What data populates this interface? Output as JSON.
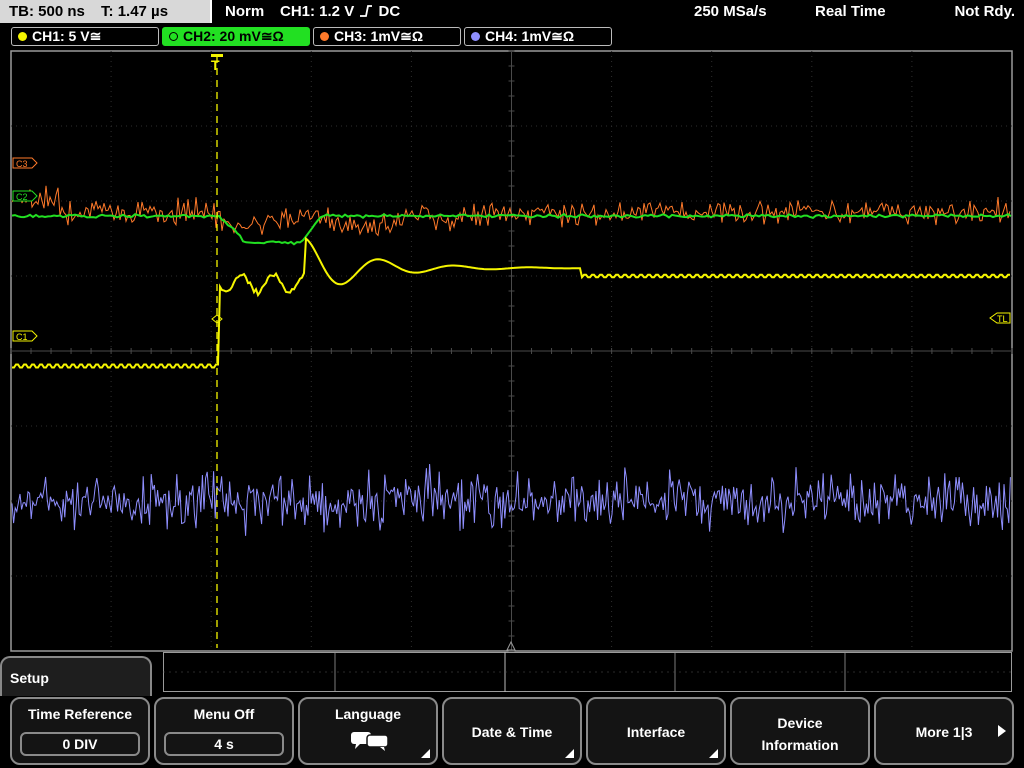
{
  "status": {
    "timebase": "TB: 500 ns",
    "trigger_time": "T: 1.47 µs",
    "mode": "Norm",
    "trigger_source": "CH1: 1.2 V",
    "trigger_coupling": "DC",
    "sample_rate": "250 MSa/s",
    "acquisition": "Real Time",
    "state": "Not Rdy."
  },
  "channels": [
    {
      "label": "CH1: 5 V",
      "suffix": "≅",
      "color": "#f5f500"
    },
    {
      "label": "CH2: 20 mV",
      "suffix": "≅Ω",
      "color": "#22e022"
    },
    {
      "label": "CH3: 1mV",
      "suffix": "≅Ω",
      "color": "#ff7a2a"
    },
    {
      "label": "CH4: 1mV",
      "suffix": "≅Ω",
      "color": "#8f8fff"
    }
  ],
  "markers": {
    "ch1": "C1",
    "ch2": "C2",
    "ch3": "C3",
    "trigger_level": "TL"
  },
  "waveform_data": {
    "grid_divisions": {
      "x": 10,
      "y": 8
    },
    "trigger_position_div": 2.07,
    "CH1": {
      "pre_trigger_div": -0.2,
      "post_trigger_steady_div": 1.0,
      "steady_from_div": 5.7
    },
    "CH2": {
      "baseline_div": 1.8,
      "dip_div": 1.45,
      "dip_start_div": 2.3,
      "dip_end_div": 2.9
    },
    "CH3": {
      "noise_center_div": 1.85
    },
    "CH4": {
      "noise_center_div": -2.0
    }
  },
  "menu": {
    "title": "Setup",
    "softkeys": [
      {
        "label": "Time Reference",
        "value": "0 DIV"
      },
      {
        "label": "Menu Off",
        "value": "4 s"
      },
      {
        "label": "Language"
      },
      {
        "label": "Date & Time"
      },
      {
        "label": "Interface"
      },
      {
        "label_line1": "Device",
        "label_line2": "Information"
      },
      {
        "label": "More 1|3"
      }
    ]
  }
}
